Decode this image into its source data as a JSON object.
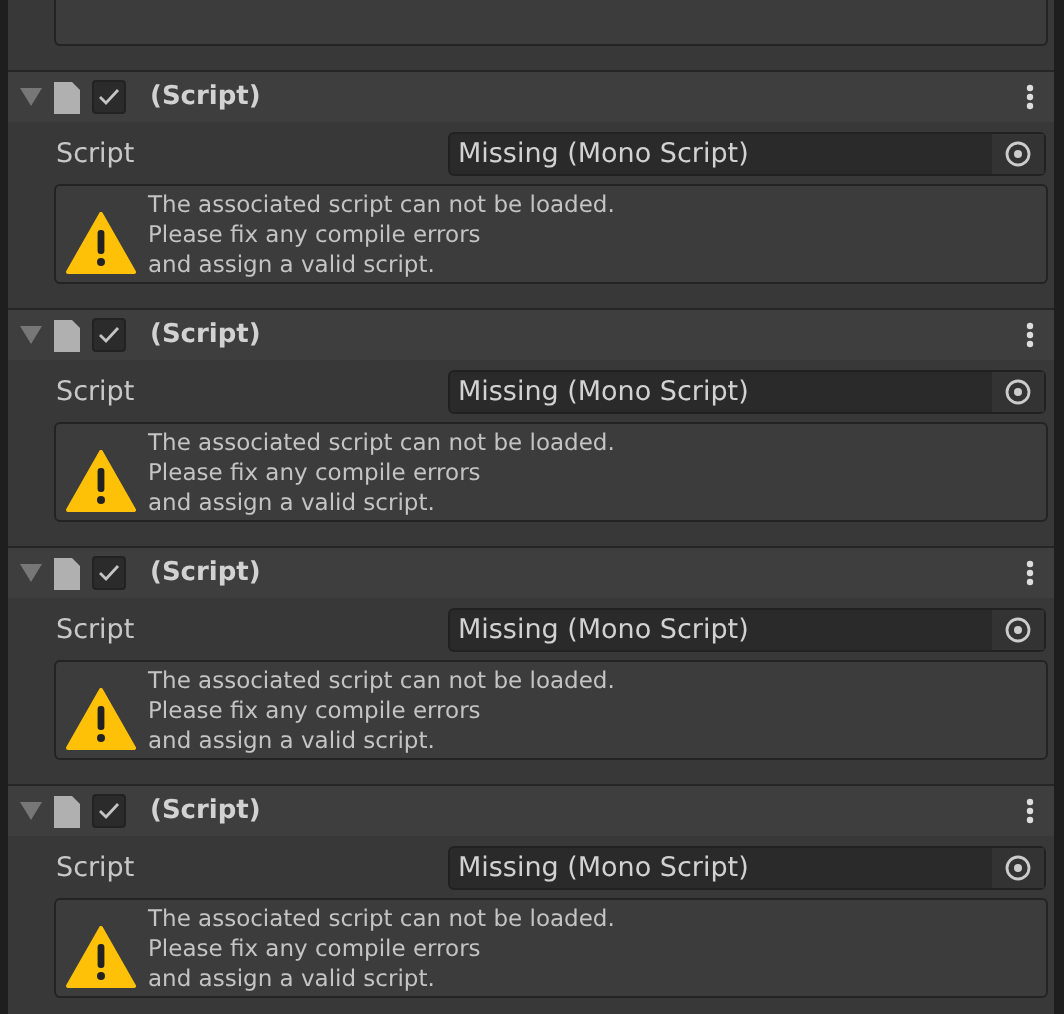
{
  "components": [
    {
      "title": "(Script)",
      "expanded": true,
      "enabled": true,
      "field_label": "Script",
      "field_value": "Missing (Mono Script)",
      "message": "The associated script can not be loaded.\nPlease fix any compile errors\nand assign a valid script."
    },
    {
      "title": "(Script)",
      "expanded": true,
      "enabled": true,
      "field_label": "Script",
      "field_value": "Missing (Mono Script)",
      "message": "The associated script can not be loaded.\nPlease fix any compile errors\nand assign a valid script."
    },
    {
      "title": "(Script)",
      "expanded": true,
      "enabled": true,
      "field_label": "Script",
      "field_value": "Missing (Mono Script)",
      "message": "The associated script can not be loaded.\nPlease fix any compile errors\nand assign a valid script."
    },
    {
      "title": "(Script)",
      "expanded": true,
      "enabled": true,
      "field_label": "Script",
      "field_value": "Missing (Mono Script)",
      "message": "The associated script can not be loaded.\nPlease fix any compile errors\nand assign a valid script."
    }
  ]
}
